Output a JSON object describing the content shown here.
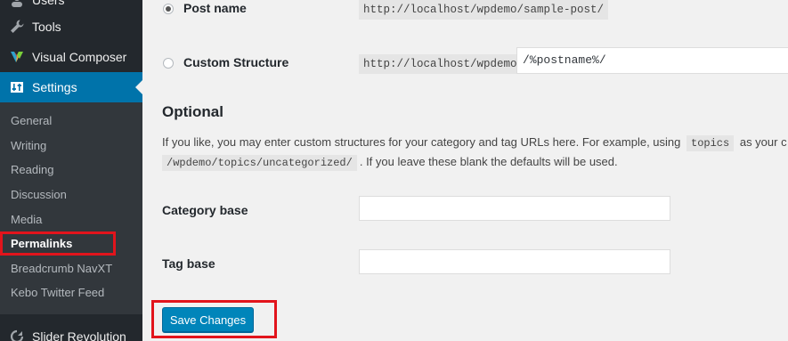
{
  "sidebar": {
    "top_items": {
      "users": "Users",
      "tools": "Tools",
      "visual_composer": "Visual Composer",
      "settings": "Settings",
      "slider_revolution": "Slider Revolution"
    },
    "submenu": [
      "General",
      "Writing",
      "Reading",
      "Discussion",
      "Media",
      "Permalinks",
      "Breadcrumb NavXT",
      "Kebo Twitter Feed"
    ],
    "current_submenu": "Permalinks"
  },
  "permalink_options": {
    "post_name": {
      "label": "Post name",
      "example": "http://localhost/wpdemo/sample-post/",
      "selected": true
    },
    "custom_structure": {
      "label": "Custom Structure",
      "prefix": "http://localhost/wpdemo",
      "value": "/%postname%/",
      "selected": false
    }
  },
  "optional": {
    "heading": "Optional",
    "desc_part1": "If you like, you may enter custom structures for your category and tag URLs here. For example, using",
    "desc_code1": "topics",
    "desc_part2": "as your c",
    "desc_code2": "/wpdemo/topics/uncategorized/",
    "desc_part3": ". If you leave these blank the defaults will be used.",
    "category_base_label": "Category base",
    "category_base_value": "",
    "tag_base_label": "Tag base",
    "tag_base_value": ""
  },
  "save_button": "Save Changes",
  "colors": {
    "sidebar_bg": "#23282d",
    "submenu_bg": "#32373c",
    "active_menu": "#0073aa",
    "primary_button": "#0085ba",
    "highlight_box": "#e2141c"
  }
}
